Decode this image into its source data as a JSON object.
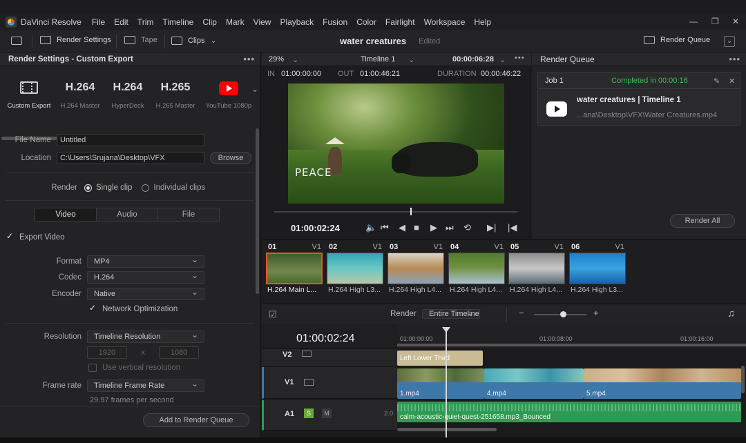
{
  "menu": {
    "app_name": "DaVinci Resolve",
    "items": [
      "File",
      "Edit",
      "Trim",
      "Timeline",
      "Clip",
      "Mark",
      "View",
      "Playback",
      "Fusion",
      "Color",
      "Fairlight",
      "Workspace",
      "Help"
    ]
  },
  "toolbar": {
    "render_settings": "Render Settings",
    "tape": "Tape",
    "clips": "Clips",
    "project_title": "water creatures",
    "project_status": "Edited",
    "render_queue": "Render Queue"
  },
  "render_settings": {
    "title": "Render Settings - Custom Export",
    "presets": [
      {
        "big": "",
        "caption": "Custom Export",
        "icon": "film-icon"
      },
      {
        "big": "H.264",
        "caption": "H.264 Master"
      },
      {
        "big": "H.264",
        "caption": "HyperDeck"
      },
      {
        "big": "H.265",
        "caption": "H.265 Master"
      },
      {
        "big": "",
        "caption": "YouTube 1080p",
        "icon": "youtube-icon"
      }
    ],
    "file_name_label": "File Name",
    "file_name_value": "Untitled",
    "location_label": "Location",
    "location_value": "C:\\Users\\Srujana\\Desktop\\VFX",
    "browse": "Browse",
    "render_label": "Render",
    "single_clip": "Single clip",
    "individual_clips": "Individual clips",
    "tabs": [
      "Video",
      "Audio",
      "File"
    ],
    "export_video": "Export Video",
    "format_label": "Format",
    "format_value": "MP4",
    "codec_label": "Codec",
    "codec_value": "H.264",
    "encoder_label": "Encoder",
    "encoder_value": "Native",
    "network_optimization": "Network Optimization",
    "resolution_label": "Resolution",
    "resolution_value": "Timeline Resolution",
    "res_w": "1920",
    "res_x": "x",
    "res_h": "1080",
    "use_vertical": "Use vertical resolution",
    "frame_rate_label": "Frame rate",
    "frame_rate_value": "Timeline Frame Rate",
    "fps_note": "29.97 frames per second",
    "add_to_queue": "Add to Render Queue"
  },
  "viewer": {
    "zoom": "29%",
    "timeline_name": "Timeline 1",
    "timecode_top": "00:00:06:28",
    "in_label": "IN",
    "in_value": "01:00:00:00",
    "out_label": "OUT",
    "out_value": "01:00:46:21",
    "duration_label": "DURATION",
    "duration_value": "00:00:46:22",
    "caption": "PEACE",
    "current_tc": "01:00:02:24",
    "scrub_fraction": 0.56
  },
  "render_queue": {
    "title": "Render Queue",
    "job": "Job 1",
    "status": "Completed in 00:00:16",
    "job_title": "water creatures | Timeline 1",
    "job_path": "...ana\\Desktop\\VFX\\Water Creatures.mp4",
    "render_all": "Render All"
  },
  "clips": [
    {
      "num": "01",
      "track": "V1",
      "name": "H.264 Main L...",
      "selected": true
    },
    {
      "num": "02",
      "track": "V1",
      "name": "H.264 High L3..."
    },
    {
      "num": "03",
      "track": "V1",
      "name": "H.264 High L4..."
    },
    {
      "num": "04",
      "track": "V1",
      "name": "H.264 High L4..."
    },
    {
      "num": "05",
      "track": "V1",
      "name": "H.264 High L4..."
    },
    {
      "num": "06",
      "track": "V1",
      "name": "H.264 High L3..."
    }
  ],
  "render_bar": {
    "label": "Render",
    "option": "Entire Timeline",
    "minus": "−",
    "plus": "+"
  },
  "timeline": {
    "timecode": "01:00:02:24",
    "ruler": [
      "01:00:00:00",
      "01:00:08:00",
      "01:00:16:00"
    ],
    "tracks": {
      "v2": "V2",
      "v1": "V1",
      "a1": "A1",
      "a1_s": "S",
      "a1_m": "M",
      "a1_level": "2.0"
    },
    "v2_clip": "Left Lower Third",
    "v1_clips": [
      "1.mp4",
      "4.mp4",
      "5.mp4"
    ],
    "a1_clip": "calm-acoustic-quiet-quest-251658.mp3_Bounced"
  },
  "colors": {
    "accent_green": "#3dbb56",
    "selection_orange": "#e4572e",
    "video_clip": "#3e78a8",
    "audio_clip": "#2f9a55",
    "title_clip": "#c9bb94"
  }
}
